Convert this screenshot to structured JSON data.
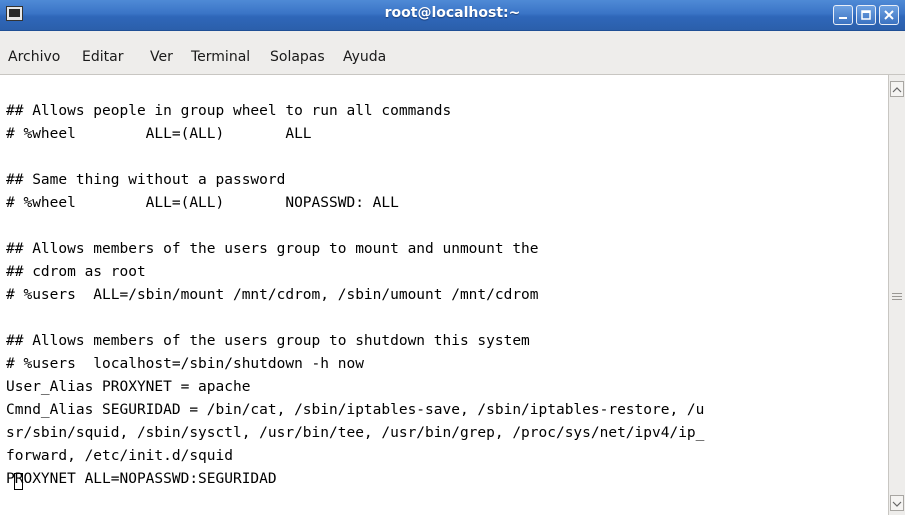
{
  "window": {
    "title": "root@localhost:~",
    "app_icon": "terminal-icon",
    "controls": [
      "minimize-icon",
      "maximize-icon",
      "close-icon"
    ]
  },
  "menu": {
    "items": [
      {
        "label": "Archivo"
      },
      {
        "label": "Editar"
      },
      {
        "label": "Ver"
      },
      {
        "label": "Terminal"
      },
      {
        "label": "Solapas"
      },
      {
        "label": "Ayuda"
      }
    ]
  },
  "terminal": {
    "lines": [
      "",
      "## Allows people in group wheel to run all commands",
      "# %wheel        ALL=(ALL)       ALL",
      "",
      "## Same thing without a password",
      "# %wheel        ALL=(ALL)       NOPASSWD: ALL",
      "",
      "## Allows members of the users group to mount and unmount the",
      "## cdrom as root",
      "# %users  ALL=/sbin/mount /mnt/cdrom, /sbin/umount /mnt/cdrom",
      "",
      "## Allows members of the users group to shutdown this system",
      "# %users  localhost=/sbin/shutdown -h now",
      "User_Alias PROXYNET = apache",
      "Cmnd_Alias SEGURIDAD = /bin/cat, /sbin/iptables-save, /sbin/iptables-restore, /u",
      "sr/sbin/squid, /sbin/sysctl, /usr/bin/tee, /usr/bin/grep, /proc/sys/net/ipv4/ip_",
      "forward, /etc/init.d/squid",
      "PROXYNET ALL=NOPASSWD:SEGURIDAD"
    ],
    "colors": {
      "background": "#ffffff",
      "foreground": "#000000"
    }
  },
  "scrollbar": {
    "up_icon": "scroll-up-arrow-icon",
    "down_icon": "scroll-down-arrow-icon",
    "grip_icon": "scroll-grip-icon"
  },
  "colors": {
    "titlebar": "#3a74c6",
    "menubar": "#eeedeb"
  }
}
